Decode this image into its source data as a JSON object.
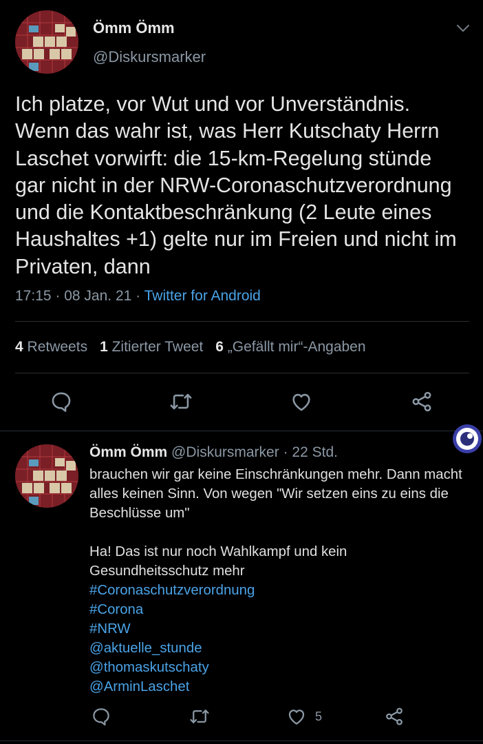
{
  "tweet": {
    "author_name": "Ömm Ömm",
    "author_handle": "@Diskursmarker",
    "text": "Ich platze, vor Wut und vor Unverständnis.\nWenn das wahr ist, was Herr Kutschaty Herrn\nLaschet vorwirft: die 15-km-Regelung stünde\ngar nicht in der NRW-Coronaschutzverordnung\nund die Kontaktbeschränkung (2 Leute eines\nHaushaltes +1) gelte nur im Freien und nicht im\nPrivaten, dann",
    "time": "17:15",
    "date": "08 Jan. 21",
    "source": "Twitter for Android",
    "stats": {
      "retweets_count": "4",
      "retweets_label": "Retweets",
      "quotes_count": "1",
      "quotes_label": "Zitierter Tweet",
      "likes_count": "6",
      "likes_label": "„Gefällt mir“-Angaben"
    },
    "actions": [
      "reply-icon",
      "retweet-icon",
      "like-icon",
      "share-icon"
    ]
  },
  "reply": {
    "author_name": "Ömm Ömm",
    "author_handle": "@Diskursmarker",
    "age": "22 Std.",
    "paragraph1": "brauchen wir gar keine Einschränkungen mehr. Dann macht alles keinen Sinn. Von wegen \"Wir setzen eins zu eins die Beschlüsse um\"",
    "paragraph2": "Ha! Das ist nur noch Wahlkampf und kein Gesundheitsschutz mehr",
    "hashtags": [
      "#Coronaschutzverordnung",
      "#Corona",
      "#NRW"
    ],
    "mentions": [
      "@aktuelle_stunde",
      "@thomaskutschaty",
      "@ArminLaschet"
    ],
    "like_count": "5"
  },
  "colors": {
    "background": "#000000",
    "text": "#e4e4e4",
    "secondary": "#8b98a5",
    "link": "#4aa3e8",
    "divider": "#2a2f33"
  }
}
